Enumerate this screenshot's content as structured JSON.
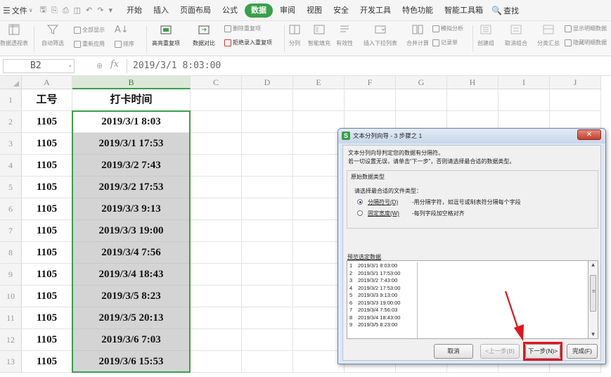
{
  "menubar": {
    "file_label": "文件",
    "tabs": [
      "开始",
      "插入",
      "页面布局",
      "公式",
      "数据",
      "审阅",
      "视图",
      "安全",
      "开发工具",
      "特色功能",
      "智能工具箱"
    ],
    "active_tab": "数据",
    "search_label": "查找"
  },
  "ribbon": {
    "pivot": "数据透视表",
    "autofilter": "自动筛选",
    "show_all": "全部显示",
    "reapply": "重新应用",
    "sort": "排序",
    "highlight_dup": "高亮重复项",
    "compare": "数据对比",
    "delete_dup": "删除重复项",
    "reject_dup": "拒绝录入重复项",
    "split": "分列",
    "smart_fill": "智能填充",
    "validity": "有效性",
    "dropdown": "插入下拉列表",
    "merge_calc": "合并计算",
    "simulate": "模拟分析",
    "record": "记录单",
    "create_group": "创建组",
    "ungroup": "取消组合",
    "subtotal": "分类汇总",
    "show_detail": "显示明细数据",
    "hide_detail": "隐藏明细数据"
  },
  "formula_bar": {
    "name_box": "B2",
    "fx": "fx",
    "content": "2019/3/1 8:03:00"
  },
  "sheet": {
    "columns": [
      "A",
      "B",
      "C",
      "D",
      "E",
      "F",
      "G",
      "H",
      "I",
      "J"
    ],
    "row_numbers": [
      "1",
      "2",
      "3",
      "4",
      "5",
      "6",
      "7",
      "8",
      "9",
      "10",
      "11",
      "12",
      "13"
    ],
    "headers": [
      "工号",
      "打卡时间"
    ],
    "ids": [
      "1105",
      "1105",
      "1105",
      "1105",
      "1105",
      "1105",
      "1105",
      "1105",
      "1105",
      "1105",
      "1105",
      "1105"
    ],
    "times": [
      "2019/3/1 8:03",
      "2019/3/1 17:53",
      "2019/3/2 7:43",
      "2019/3/2 17:53",
      "2019/3/3 9:13",
      "2019/3/3 19:00",
      "2019/3/4 7:56",
      "2019/3/4 18:43",
      "2019/3/5 8:23",
      "2019/3/5 20:13",
      "2019/3/6 7:03",
      "2019/3/6 15:53"
    ]
  },
  "dialog": {
    "title": "文本分列向导 - 3 步骤之 1",
    "desc1": "文本分列向导判定您的数据有分隔符。",
    "desc2": "若一切设置无误，请单击“下一步”，否则请选择最合适的数据类型。",
    "group_title": "原始数据类型",
    "group_prompt": "请选择最合适的文件类型：",
    "option1_label": "分隔符号(D)",
    "option1_desc": "-用分隔字符，如逗号或制表符分隔每个字段",
    "option2_label": "固定宽度(W)",
    "option2_desc": "-每列字段加空格对齐",
    "preview_label": "预览选定数据",
    "preview_rows": [
      {
        "n": "1",
        "v": "2019/3/1 8:03:00"
      },
      {
        "n": "2",
        "v": "2019/3/1 17:53:00"
      },
      {
        "n": "3",
        "v": "2019/3/2 7:43:00"
      },
      {
        "n": "4",
        "v": "2019/3/2 17:53:00"
      },
      {
        "n": "5",
        "v": "2019/3/3 9:13:00"
      },
      {
        "n": "6",
        "v": "2019/3/3 19:00:00"
      },
      {
        "n": "7",
        "v": "2019/3/4 7:56:03"
      },
      {
        "n": "8",
        "v": "2019/3/4 18:43:00"
      },
      {
        "n": "9",
        "v": "2019/3/5 8:23:00"
      }
    ],
    "cancel": "取消",
    "back": "<上一步(B)",
    "next": "下一步(N)>",
    "finish": "完成(F)"
  },
  "colors": {
    "accent_green": "#3aa04a",
    "highlight_red": "#e3141c",
    "selection_gray": "#d4d4d4"
  }
}
